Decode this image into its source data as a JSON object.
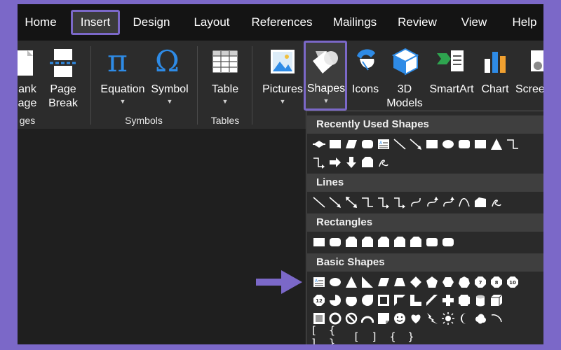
{
  "tabs": [
    "Home",
    "Insert",
    "Design",
    "Layout",
    "References",
    "Mailings",
    "Review",
    "View",
    "Help"
  ],
  "active_tab": "Insert",
  "ribbon": {
    "blank_page": {
      "line1": "ank",
      "line2": "age"
    },
    "page_break": {
      "line1": "Page",
      "line2": "Break"
    },
    "equation": "Equation",
    "symbol": "Symbol",
    "table": "Table",
    "pictures": "Pictures",
    "shapes": "Shapes",
    "icons": "Icons",
    "models_3d": {
      "line1": "3D",
      "line2": "Models"
    },
    "smartart": "SmartArt",
    "chart": "Chart",
    "screenshot": "Scree",
    "groups": {
      "pages": "ges",
      "symbols": "Symbols",
      "tables": "Tables"
    }
  },
  "equation_glyph": "π",
  "symbol_glyph": "Ω",
  "shapes_menu": {
    "recent": "Recently Used Shapes",
    "lines": "Lines",
    "rectangles": "Rectangles",
    "basic": "Basic Shapes",
    "basic_numbers": [
      "7",
      "8",
      "10",
      "12"
    ],
    "brackets": [
      "[ ]",
      "{ }",
      "[",
      "]",
      "{",
      "}"
    ]
  },
  "colors": {
    "accent": "#7b68c8",
    "icon_blue": "#2e8be6",
    "background": "#1f1f1f"
  }
}
